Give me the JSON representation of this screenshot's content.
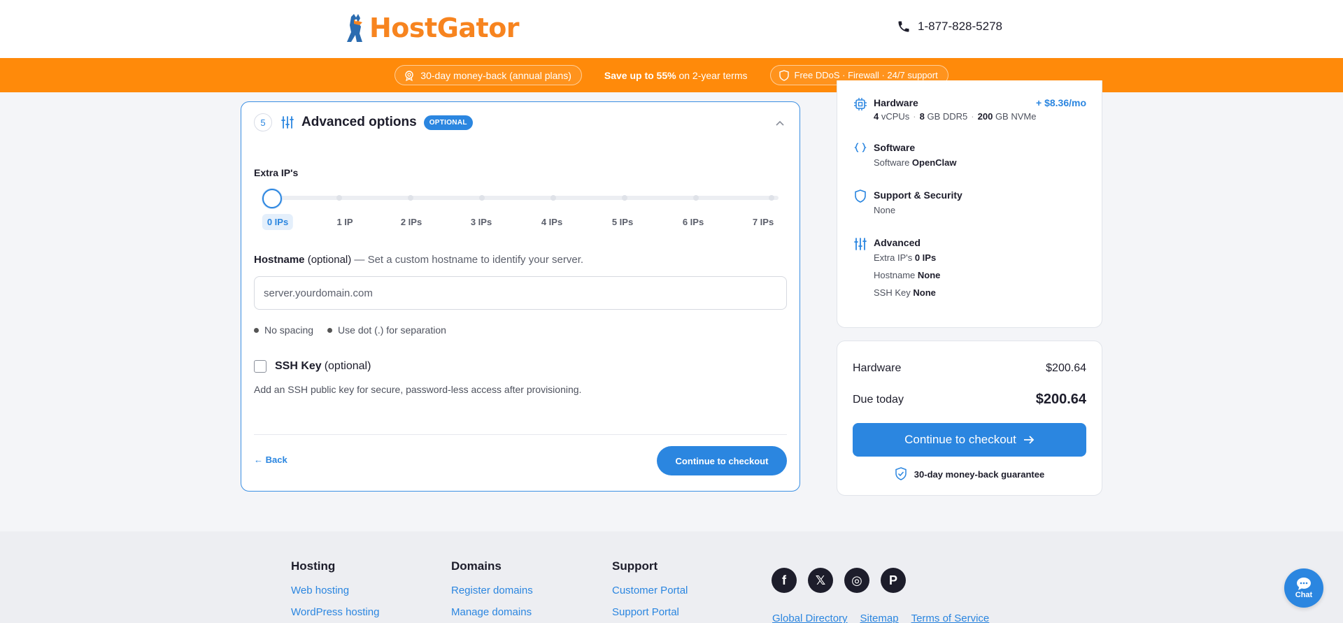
{
  "header": {
    "logo_text": "HostGator",
    "phone": "1-877-828-5278"
  },
  "promo": {
    "left_pill": "30-day money-back (annual plans)",
    "mid_bold": "Save up to 55%",
    "mid_rest": " on 2-year terms",
    "right_pill": "Free DDoS · Firewall · 24/7 support"
  },
  "step": {
    "number": "5",
    "title": "Advanced options",
    "badge": "OPTIONAL"
  },
  "extra_ips": {
    "label": "Extra IP's",
    "options": [
      "0 IPs",
      "1 IP",
      "2 IPs",
      "3 IPs",
      "4 IPs",
      "5 IPs",
      "6 IPs",
      "7 IPs"
    ],
    "selected": "0 IPs"
  },
  "hostname": {
    "label_bold": "Hostname",
    "label_optional": " (optional)",
    "label_help": " — Set a custom hostname to identify your server.",
    "placeholder": "server.yourdomain.com",
    "rule_1": "No spacing",
    "rule_2": "Use dot (.) for separation"
  },
  "ssh": {
    "label_bold": "SSH Key",
    "label_optional": "(optional)",
    "help": "Add an SSH public key for secure, password-less access after provisioning."
  },
  "actions": {
    "back": "← Back",
    "continue": "Continue to checkout"
  },
  "summary": {
    "hardware_title": "Hardware",
    "hardware_price": "+ $8.36/mo",
    "hw_vcpu_num": "4",
    "hw_vcpu_unit": " vCPUs",
    "hw_ram_num": "8",
    "hw_ram_unit": " GB DDR5",
    "hw_disk_num": "200",
    "hw_disk_unit": " GB NVMe",
    "software_title": "Software",
    "software_label": "Software ",
    "software_value": "OpenClaw",
    "support_title": "Support & Security",
    "support_value": "None",
    "advanced_title": "Advanced",
    "adv_ip_label": "Extra IP's ",
    "adv_ip_value": "0 IPs",
    "adv_host_label": "Hostname ",
    "adv_host_value": "None",
    "adv_ssh_label": "SSH Key ",
    "adv_ssh_value": "None"
  },
  "totals": {
    "hardware_label": "Hardware",
    "hardware_value": "$200.64",
    "due_label": "Due today",
    "due_value": "$200.64",
    "button": "Continue to checkout",
    "guarantee": "30-day money-back guarantee"
  },
  "footer": {
    "col1_title": "Hosting",
    "col1_links": [
      "Web hosting",
      "WordPress hosting"
    ],
    "col2_title": "Domains",
    "col2_links": [
      "Register domains",
      "Manage domains"
    ],
    "col3_title": "Support",
    "col3_links": [
      "Customer Portal",
      "Support Portal"
    ],
    "bottom_links": [
      "Global Directory",
      "Sitemap",
      "Terms of Service"
    ],
    "social_f": "f",
    "social_x": "𝕏",
    "social_ig": "◎",
    "social_p": "P"
  },
  "chat": {
    "label": "Chat"
  },
  "colors": {
    "brand_orange": "#f7841f",
    "promo_orange": "#ff8a0a",
    "accent_blue": "#2b86e0"
  }
}
